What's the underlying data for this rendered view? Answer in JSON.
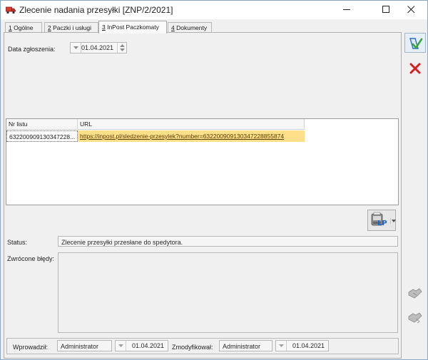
{
  "window": {
    "title": "Zlecenie nadania przesyłki [ZNP/2/2021]"
  },
  "tabs": [
    {
      "num": "1",
      "label": " Ogólne"
    },
    {
      "num": "2",
      "label": " Paczki i usługi"
    },
    {
      "num": "3",
      "label": " InPost Paczkomaty"
    },
    {
      "num": "4",
      "label": " Dokumenty"
    }
  ],
  "form": {
    "date_label": "Data zgłoszenia:",
    "date_value": "01.04.2021"
  },
  "grid": {
    "columns": [
      "Nr listu",
      "URL"
    ],
    "rows": [
      {
        "nr": "632200909130347228...",
        "url": "https://inpost.pl/sledzenie-przesylek?number=632200909130347228855874"
      }
    ]
  },
  "status": {
    "label": "Status:",
    "value": "Zlecenie przesyłki przesłane do spedytora."
  },
  "errors": {
    "label": "Zwrócone błędy:",
    "value": ""
  },
  "footer": {
    "entered_label": "Wprowadził:",
    "entered_by": "Administrator",
    "entered_date": "01.04.2021",
    "modified_label": "Zmodyfikował:",
    "modified_by": "Administrator",
    "modified_date": "01.04.2021"
  },
  "lp_button": {
    "text": "LP"
  },
  "icons": {
    "app": "truck-icon",
    "save": "save-disk-icon",
    "cancel": "close-x-icon",
    "lp": "label-printer-icon",
    "tool1": "handshake-icon",
    "tool2": "handshake-icon"
  },
  "colors": {
    "url_highlight": "#ffe08a",
    "cancel_red": "#d81e1e",
    "save_blue": "#2d6fc4",
    "save_green": "#39a83a"
  }
}
